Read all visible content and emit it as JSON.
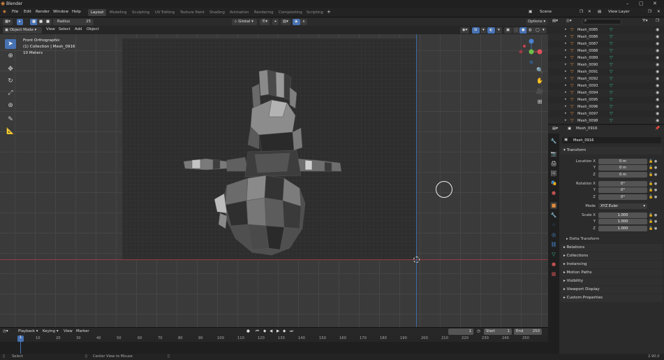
{
  "app": {
    "title": "Blender",
    "version": "2.90.0"
  },
  "window_controls": {
    "minimize": "–",
    "maximize": "▢",
    "close": "✕"
  },
  "menu": [
    "File",
    "Edit",
    "Render",
    "Window",
    "Help"
  ],
  "workspaces": [
    "Layout",
    "Modeling",
    "Sculpting",
    "UV Editing",
    "Texture Paint",
    "Shading",
    "Animation",
    "Rendering",
    "Compositing",
    "Scripting"
  ],
  "scene": {
    "label": "Scene",
    "view_layer": "View Layer"
  },
  "tool_header": {
    "radius_label": "Radius",
    "radius_value": "25",
    "orientation": "Global",
    "options": "Options"
  },
  "viewport_header": {
    "mode": "Object Mode",
    "menus": [
      "View",
      "Select",
      "Add",
      "Object"
    ]
  },
  "overlay": {
    "view_name": "Front Orthographic",
    "collection": "(1) Collection | Mesh_0916",
    "scale": "10 Meters"
  },
  "outliner": {
    "search_placeholder": "",
    "items": [
      "Mesh_0085",
      "Mesh_0086",
      "Mesh_0087",
      "Mesh_0088",
      "Mesh_0089",
      "Mesh_0090",
      "Mesh_0091",
      "Mesh_0092",
      "Mesh_0093",
      "Mesh_0094",
      "Mesh_0095",
      "Mesh_0096",
      "Mesh_0097",
      "Mesh_0098"
    ]
  },
  "properties": {
    "object_name": "Mesh_0916",
    "transform_title": "Transform",
    "location": {
      "label": "Location X",
      "x": "0 m",
      "y": "0 m",
      "z": "0 m"
    },
    "rotation": {
      "label": "Rotation X",
      "x": "0°",
      "y": "0°",
      "z": "0°"
    },
    "mode": {
      "label": "Mode",
      "value": "XYZ Euler"
    },
    "scale": {
      "label": "Scale X",
      "x": "1.000",
      "y": "1.000",
      "z": "1.000"
    },
    "axis_y": "Y",
    "axis_z": "Z",
    "delta": "Delta Transform",
    "panels": [
      "Relations",
      "Collections",
      "Instancing",
      "Motion Paths",
      "Visibility",
      "Viewport Display",
      "Custom Properties"
    ]
  },
  "timeline": {
    "menus": [
      "Playback",
      "Keying",
      "View",
      "Marker"
    ],
    "current_frame": "1",
    "start_label": "Start",
    "start": "1",
    "end_label": "End",
    "end": "250",
    "ticks": [
      "10",
      "20",
      "30",
      "40",
      "50",
      "60",
      "70",
      "80",
      "90",
      "100",
      "110",
      "120",
      "130",
      "140",
      "150",
      "160",
      "170",
      "180",
      "190",
      "200",
      "210",
      "220",
      "230",
      "240",
      "250"
    ]
  },
  "status": {
    "left": "Select",
    "middle": "Center View to Mouse"
  },
  "colors": {
    "accent": "#4772b3",
    "mesh_icon": "#e08b3d",
    "data_icon": "#36c39d",
    "x_axis": "#9a3a45",
    "z_axis": "#3d6aa6"
  }
}
